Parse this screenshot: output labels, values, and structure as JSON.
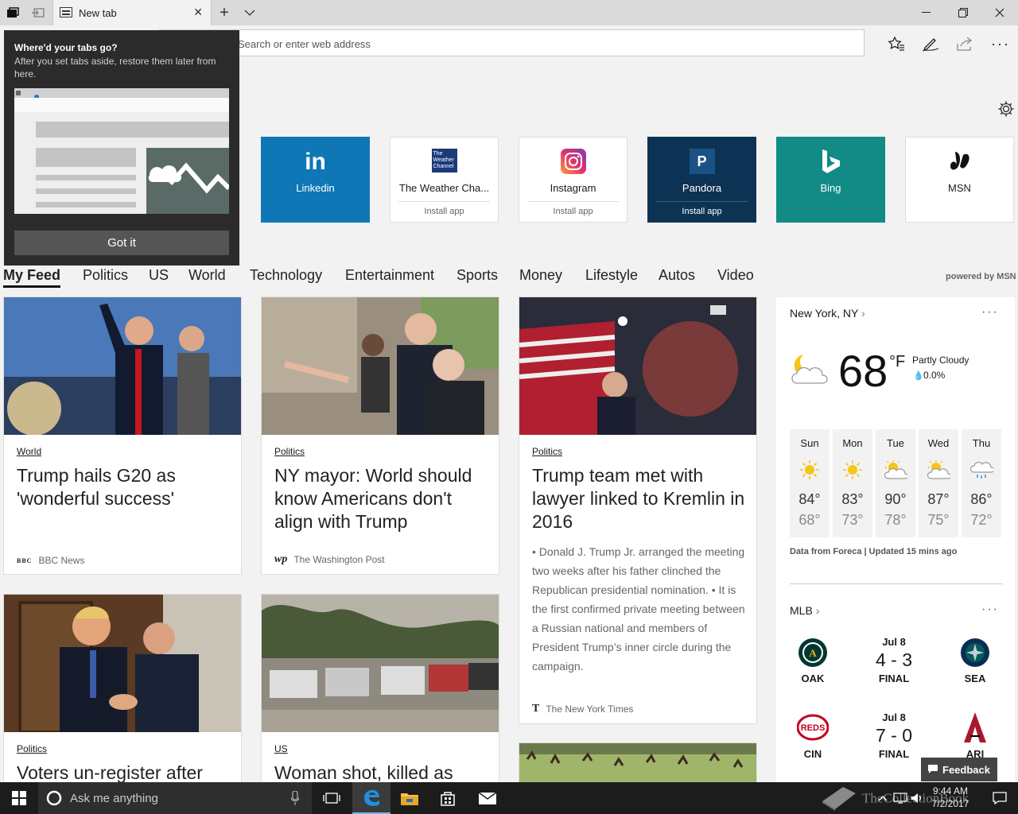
{
  "browser": {
    "tab_title": "New tab",
    "address_placeholder": "Search or enter web address"
  },
  "popup": {
    "heading": "Where'd your tabs go?",
    "body": "After you set tabs aside, restore them later from here.",
    "button": "Got it"
  },
  "top_sites": [
    {
      "label": "Linkedin",
      "sub": "",
      "color": "#0f77b5",
      "icon": "linkedin-icon"
    },
    {
      "label": "The Weather Cha...",
      "sub": "Install app",
      "color": "#ffffff",
      "icon": "weather-channel-icon"
    },
    {
      "label": "Instagram",
      "sub": "Install app",
      "color": "#ffffff",
      "icon": "instagram-icon"
    },
    {
      "label": "Pandora",
      "sub": "Install app",
      "color": "#0d3354",
      "icon": "pandora-icon"
    },
    {
      "label": "Bing",
      "sub": "",
      "color": "#128a86",
      "icon": "bing-icon"
    },
    {
      "label": "MSN",
      "sub": "",
      "color": "#ffffff",
      "icon": "msn-icon"
    }
  ],
  "categories": [
    "My Feed",
    "Politics",
    "US",
    "World",
    "Technology",
    "Entertainment",
    "Sports",
    "Money",
    "Lifestyle",
    "Autos",
    "Video"
  ],
  "powered_by": "powered by MSN",
  "cards": [
    {
      "tag": "World",
      "title": "Trump hails G20 as 'wonderful success'",
      "source": "BBC News",
      "logo": "BBC"
    },
    {
      "tag": "Politics",
      "title": "NY mayor: World should know Americans don't align with Trump",
      "source": "The Washington Post",
      "logo": "wp"
    },
    {
      "tag": "Politics",
      "title": "Trump team met with lawyer linked to Kremlin in 2016",
      "summary": "• Donald J. Trump Jr. arranged the meeting two weeks after his father clinched the Republican presidential nomination. • It is the first confirmed private meeting between a Russian national and members of President Trump’s inner circle during the campaign.",
      "source": "The New York Times",
      "logo": "T"
    },
    {
      "tag": "Politics",
      "title": "Voters un-register after"
    },
    {
      "tag": "US",
      "title": "Woman shot, killed as"
    }
  ],
  "weather": {
    "location": "New York, NY",
    "temp": "68",
    "unit": "°F",
    "condition": "Partly Cloudy",
    "precip": "0.0%",
    "forecast": [
      {
        "day": "Sun",
        "hi": "84°",
        "lo": "68°",
        "icon": "sun-icon"
      },
      {
        "day": "Mon",
        "hi": "83°",
        "lo": "73°",
        "icon": "sun-icon"
      },
      {
        "day": "Tue",
        "hi": "90°",
        "lo": "78°",
        "icon": "partly-cloudy-icon"
      },
      {
        "day": "Wed",
        "hi": "87°",
        "lo": "75°",
        "icon": "partly-cloudy-icon"
      },
      {
        "day": "Thu",
        "hi": "86°",
        "lo": "72°",
        "icon": "rain-icon"
      }
    ],
    "credit": "Data from Foreca | Updated 15 mins ago"
  },
  "mlb": {
    "title": "MLB",
    "games": [
      {
        "away": "OAK",
        "home": "SEA",
        "date": "Jul 8",
        "score": "4 - 3",
        "status": "FINAL"
      },
      {
        "away": "CIN",
        "home": "ARI",
        "date": "Jul 8",
        "score": "7 - 0",
        "status": "FINAL"
      }
    ]
  },
  "feedback": "Feedback",
  "taskbar": {
    "search_placeholder": "Ask me anything",
    "time": "9:44 AM",
    "date": "7/2/2017"
  },
  "watermark": "TheCollectionBook"
}
